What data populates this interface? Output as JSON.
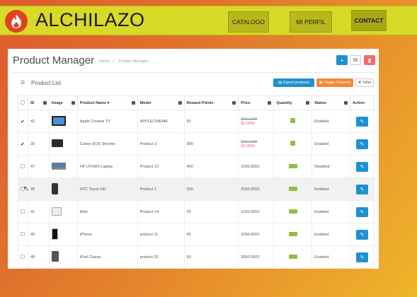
{
  "nav": {
    "brand": "ALCHILAZO",
    "items": [
      "CATALOGO",
      "MI PERFIL",
      "CONTACT"
    ]
  },
  "panel": {
    "title": "Product Manager",
    "breadcrumb": [
      "Home",
      "/",
      "Product Manager"
    ],
    "list_title": "Product List",
    "buttons": {
      "export": "Export products",
      "toggle": "Toggle Columns",
      "filter": "Filter"
    },
    "columns": [
      "ID",
      "Image",
      "Product Name",
      "Model",
      "Reward Points",
      "Price",
      "Quantity",
      "Status",
      "Action"
    ],
    "rows": [
      {
        "checked": true,
        "id": "42",
        "img": "monitor",
        "name": "Apple Cinema TV",
        "model": "APPLECINEMA",
        "reward": "50",
        "price": "$10.1200",
        "special": "$0.0000",
        "status": "Enabled"
      },
      {
        "checked": true,
        "id": "30",
        "img": "camera",
        "name": "Canon EOS Shooter",
        "model": "Product 3",
        "reward": "999",
        "price": "$10.1200",
        "special": "$2.0000",
        "status": "Enabled"
      },
      {
        "checked": false,
        "id": "47",
        "img": "laptop",
        "name": "HP LP3065 Laptop",
        "model": "Product 12",
        "reward": "450",
        "price": "3150.0003",
        "special": "",
        "status": "Disabled"
      },
      {
        "checked": false,
        "id": "28",
        "img": "phone",
        "name": "HTC Touch HD",
        "model": "Product 1",
        "reward": "250",
        "price": "3150.0003",
        "special": "",
        "status": "Enabled"
      },
      {
        "checked": false,
        "id": "41",
        "img": "imac",
        "name": "iMac",
        "model": "Product 14",
        "reward": "50",
        "price": "3150.0003",
        "special": "",
        "status": "Enabled"
      },
      {
        "checked": false,
        "id": "40",
        "img": "iphone",
        "name": "iPhone",
        "model": "product 11",
        "reward": "50",
        "price": "3030.0003",
        "special": "",
        "status": "Enabled"
      },
      {
        "checked": false,
        "id": "48",
        "img": "ipod",
        "name": "iPod Classic",
        "model": "product 20",
        "reward": "50",
        "price": "3000.0003",
        "special": "",
        "status": "Enabled"
      }
    ]
  },
  "colors": {
    "accent": "#1e91cf",
    "nav_bar": "#d9d927",
    "logo": "#e2421f",
    "toggle_btn": "#f38733",
    "delete_btn": "#f56b6b"
  }
}
